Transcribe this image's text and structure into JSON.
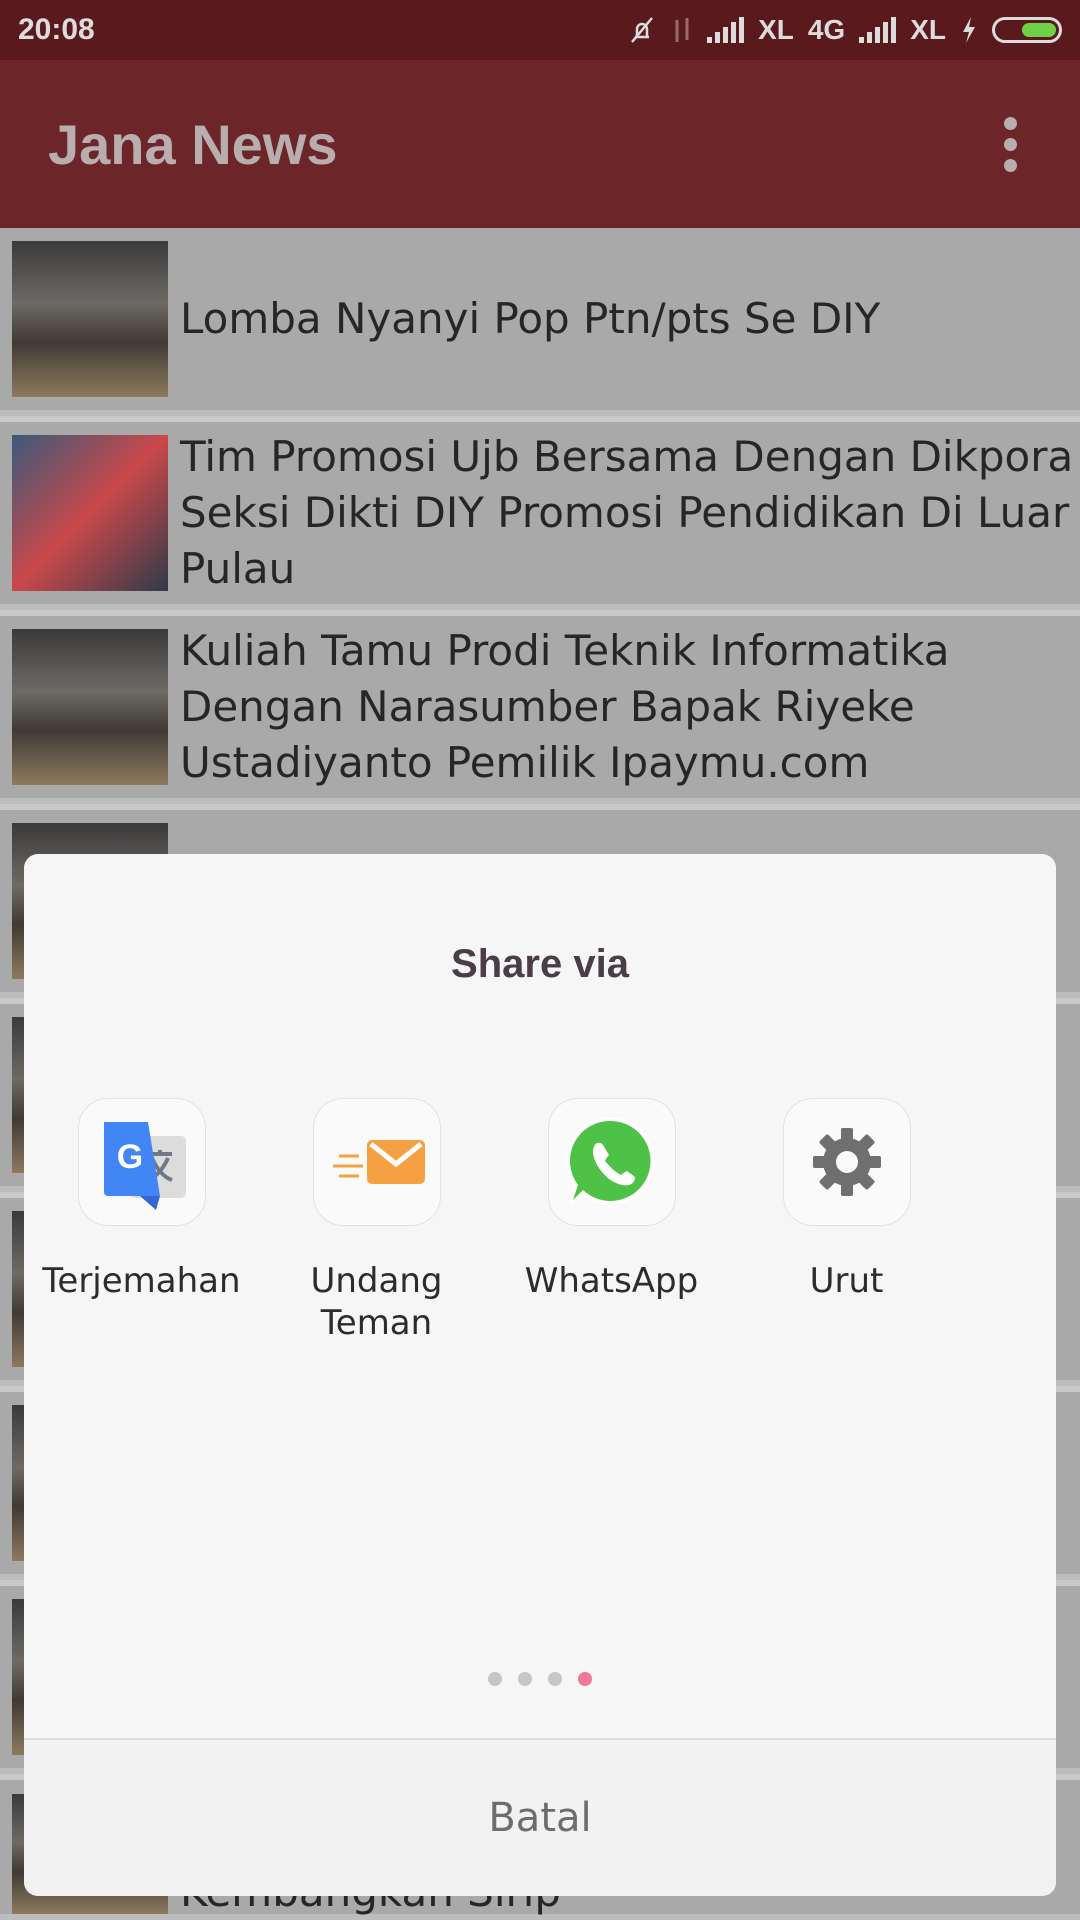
{
  "status_bar": {
    "time": "20:08",
    "carrier1": "XL",
    "network": "4G",
    "carrier2": "XL",
    "battery_color": "#6ed145"
  },
  "app_bar": {
    "title": "Jana News",
    "menu_icon": "more-vert-icon"
  },
  "news_items": [
    {
      "title": "Lomba Nyanyi Pop Ptn/pts Se DIY"
    },
    {
      "title": "Tim Promosi Ujb Bersama Dengan Dikpora Seksi Dikti DIY Promosi Pendidikan Di Luar Pulau"
    },
    {
      "title": "Kuliah Tamu Prodi Teknik Informatika Dengan Narasumber Bapak Riyeke Ustadiyanto Pemilik Ipaymu.com"
    },
    {
      "title": "Kembangkan Sirip"
    }
  ],
  "share_dialog": {
    "title": "Share via",
    "apps": [
      {
        "label": "Terjemahan",
        "icon": "google-translate-icon"
      },
      {
        "label": "Undang Teman",
        "icon": "mail-icon"
      },
      {
        "label": "WhatsApp",
        "icon": "whatsapp-icon"
      },
      {
        "label": "Urut",
        "icon": "gear-icon"
      }
    ],
    "page_count": 4,
    "active_page": 4,
    "cancel_label": "Batal"
  }
}
